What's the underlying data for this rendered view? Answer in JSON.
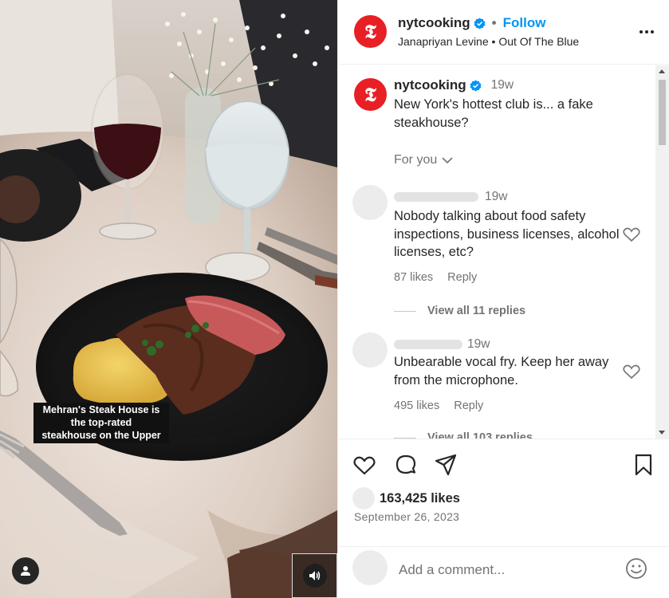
{
  "media": {
    "caption_lines": [
      "Mehran's Steak House is",
      "the top-rated",
      "steakhouse on the Upper"
    ]
  },
  "header": {
    "account": "nytcooking",
    "separator": "•",
    "follow_label": "Follow",
    "audio_credit": "Janapriyan Levine • Out Of The Blue",
    "logo_glyph": "𝕿"
  },
  "post": {
    "account": "nytcooking",
    "time": "19w",
    "caption": "New York's hottest club is... a fake steakhouse?",
    "filter_label": "For you"
  },
  "comments": [
    {
      "time": "19w",
      "text": "Nobody talking about food safety inspections, business licenses, alcohol licenses, etc?",
      "likes": "87 likes",
      "reply_label": "Reply",
      "view_replies": "View all 11 replies"
    },
    {
      "time": "19w",
      "text": "Unbearable vocal fry. Keep her away from the microphone.",
      "likes": "495 likes",
      "reply_label": "Reply",
      "view_replies": "View all 103 replies"
    }
  ],
  "footer": {
    "likes": "163,425 likes",
    "date": "September 26, 2023",
    "comment_placeholder": "Add a comment..."
  },
  "colors": {
    "brand_red": "#e81f25",
    "link_blue": "#0095f6",
    "verified_blue": "#0095f6"
  }
}
